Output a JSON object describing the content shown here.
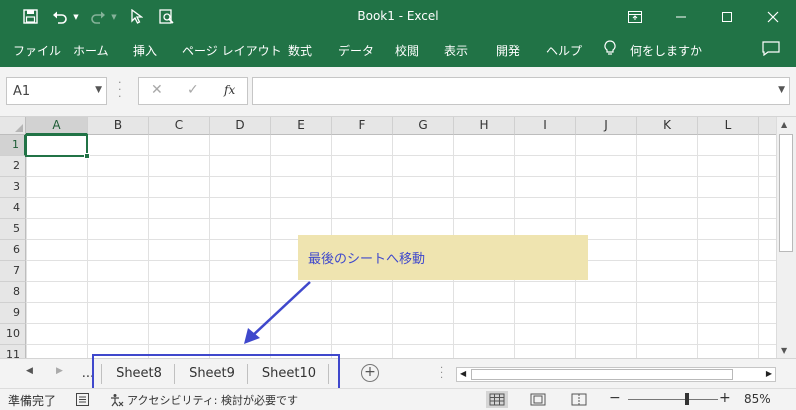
{
  "titlebar": {
    "title": "Book1  -  Excel",
    "bg": "#217346",
    "quick_access": [
      {
        "name": "save-icon"
      },
      {
        "name": "undo-icon"
      },
      {
        "name": "redo-icon"
      },
      {
        "name": "select-objects-icon"
      },
      {
        "name": "print-preview-icon"
      }
    ],
    "window_buttons": [
      "ribbon-display-options-icon",
      "minimize-icon",
      "maximize-icon",
      "close-icon"
    ]
  },
  "ribbon": {
    "tabs": [
      "ファイル",
      "ホーム",
      "挿入",
      "ページ レイアウト",
      "数式",
      "データ",
      "校閲",
      "表示",
      "開発",
      "ヘルプ"
    ],
    "tell_me": "何をしますか",
    "tell_me_icon": "lightbulb-icon",
    "comments_icon": "comment-icon"
  },
  "formula_bar": {
    "name_box": "A1",
    "cancel": "✕",
    "enter": "✓",
    "function": "fx",
    "formula": ""
  },
  "grid": {
    "columns": [
      "A",
      "B",
      "C",
      "D",
      "E",
      "F",
      "G",
      "H",
      "I",
      "J",
      "K",
      "L"
    ],
    "rows": [
      "1",
      "2",
      "3",
      "4",
      "5",
      "6",
      "7",
      "8",
      "9",
      "10",
      "11"
    ],
    "selected_cell": "A1"
  },
  "callout": {
    "text": "最後のシートへ移動",
    "bg": "#efe4b0",
    "text_color": "#3f48cc"
  },
  "sheet_tabs": {
    "ellipsis": "...",
    "tabs": [
      "Sheet8",
      "Sheet9",
      "Sheet10"
    ],
    "add_label": "+"
  },
  "status_bar": {
    "ready": "準備完了",
    "accessibility": "アクセシビリティ: 検討が必要です",
    "zoom": "85%",
    "zoom_minus": "−",
    "zoom_plus": "+"
  }
}
